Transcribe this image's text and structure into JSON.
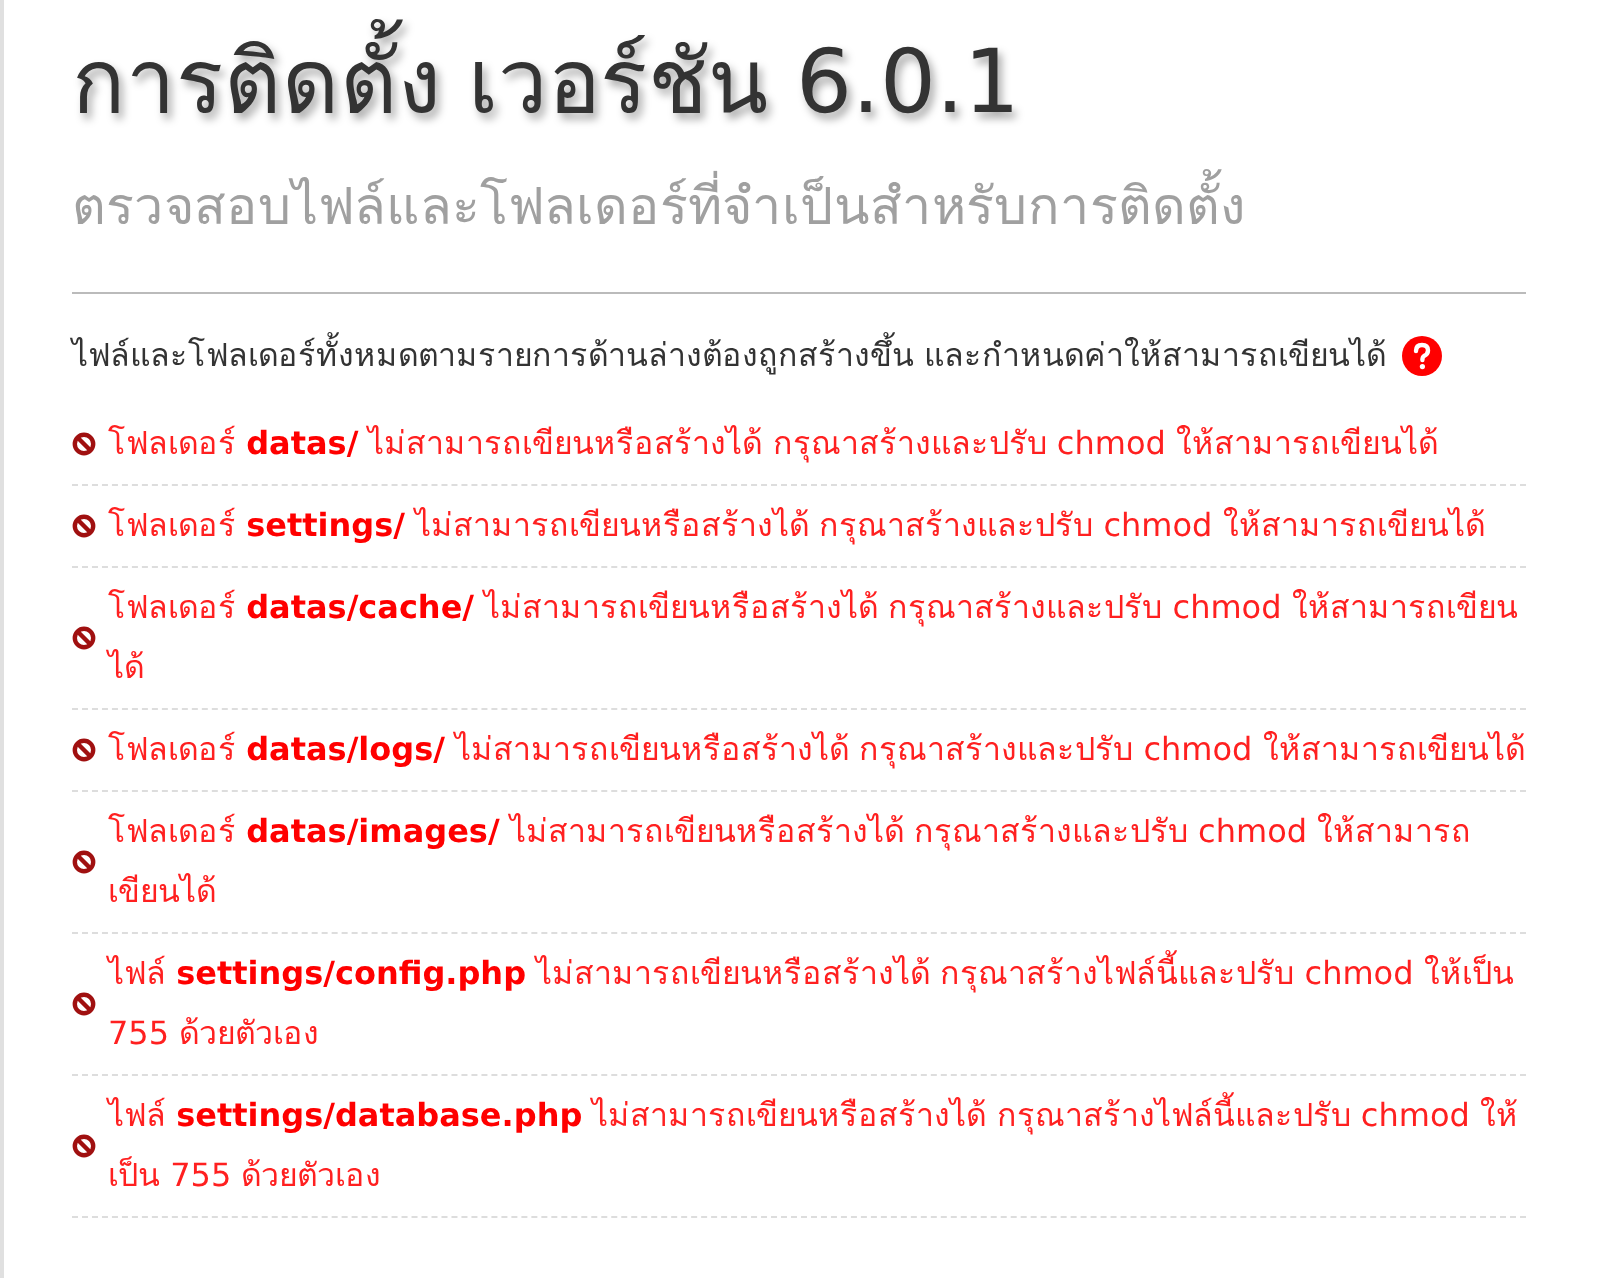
{
  "title": "การติดตั้ง เวอร์ชัน 6.0.1",
  "subtitle": "ตรวจสอบไฟล์และโฟลเดอร์ที่จำเป็นสำหรับการติดตั้ง",
  "intro": "ไฟล์และโฟลเดอร์ทั้งหมดตามรายการด้านล่างต้องถูกสร้างขึ้น และกำหนดค่าให้สามารถเขียนได้",
  "errors": [
    {
      "text": "โฟลเดอร์ **datas/** ไม่สามารถเขียนหรือสร้างได้ กรุณาสร้างและปรับ chmod ให้สามารถเขียนได้"
    },
    {
      "text": "โฟลเดอร์ **settings/** ไม่สามารถเขียนหรือสร้างได้ กรุณาสร้างและปรับ chmod ให้สามารถเขียนได้"
    },
    {
      "text": "โฟลเดอร์ **datas/cache/** ไม่สามารถเขียนหรือสร้างได้ กรุณาสร้างและปรับ chmod ให้สามารถเขียนได้"
    },
    {
      "text": "โฟลเดอร์ **datas/logs/** ไม่สามารถเขียนหรือสร้างได้ กรุณาสร้างและปรับ chmod ให้สามารถเขียนได้"
    },
    {
      "text": "โฟลเดอร์ **datas/images/** ไม่สามารถเขียนหรือสร้างได้ กรุณาสร้างและปรับ chmod ให้สามารถเขียนได้"
    },
    {
      "text": "ไฟล์ **settings/config.php** ไม่สามารถเขียนหรือสร้างได้ กรุณาสร้างไฟล์นี้และปรับ chmod ให้เป็น 755 ด้วยตัวเอง"
    },
    {
      "text": "ไฟล์ **settings/database.php** ไม่สามารถเขียนหรือสร้างได้ กรุณาสร้างไฟล์นี้และปรับ chmod ให้เป็น 755 ด้วยตัวเอง"
    }
  ]
}
